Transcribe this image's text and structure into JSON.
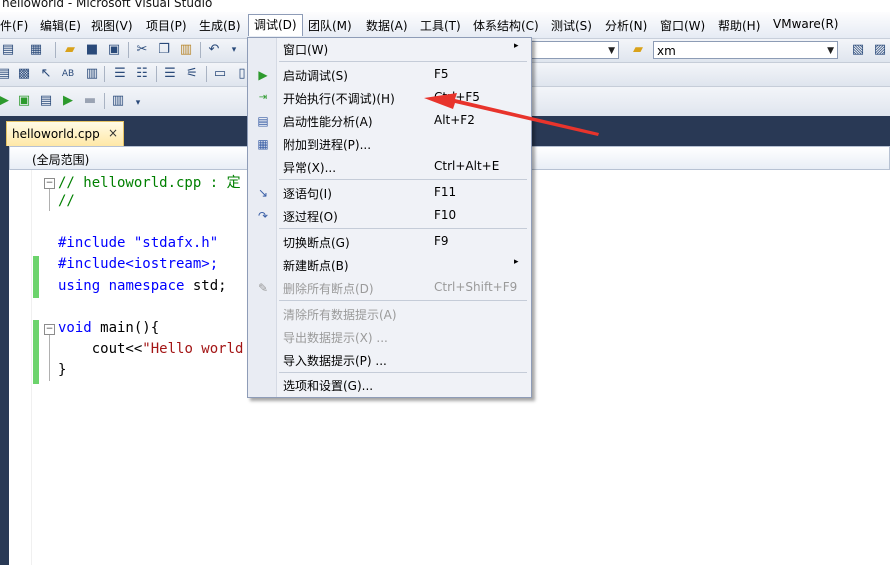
{
  "window": {
    "title": "helloworld - Microsoft Visual Studio"
  },
  "menubar": {
    "items": [
      {
        "label": "件(F)",
        "name": "menu-file"
      },
      {
        "label": "编辑(E)",
        "name": "menu-edit"
      },
      {
        "label": "视图(V)",
        "name": "menu-view"
      },
      {
        "label": "项目(P)",
        "name": "menu-project"
      },
      {
        "label": "生成(B)",
        "name": "menu-build"
      },
      {
        "label": "调试(D)",
        "name": "menu-debug"
      },
      {
        "label": "团队(M)",
        "name": "menu-team"
      },
      {
        "label": "数据(A)",
        "name": "menu-data"
      },
      {
        "label": "工具(T)",
        "name": "menu-tools"
      },
      {
        "label": "体系结构(C)",
        "name": "menu-architecture"
      },
      {
        "label": "测试(S)",
        "name": "menu-test"
      },
      {
        "label": "分析(N)",
        "name": "menu-analyze"
      },
      {
        "label": "窗口(W)",
        "name": "menu-window"
      },
      {
        "label": "帮助(H)",
        "name": "menu-help"
      },
      {
        "label": "VMware(R)",
        "name": "menu-vmware"
      }
    ]
  },
  "toolbar": {
    "search_combo_value": "xm"
  },
  "tabs": {
    "active_file": "helloworld.cpp",
    "close_glyph": "×"
  },
  "navbar": {
    "scope": "(全局范围)"
  },
  "editor": {
    "lines": [
      {
        "c": "// helloworld.cpp : 定"
      },
      {
        "c": "//"
      },
      {
        "inc": "#include \"stdafx.h\""
      },
      {
        "inc": "#include<iostream>;"
      },
      {
        "kw1": "using",
        "kw2": "namespace",
        "rest": " std;"
      },
      {
        "kw": "void",
        "rest": " main(){"
      },
      {
        "pre": "    cout<<",
        "str": "\"Hello world"
      },
      {
        "rest": "}"
      }
    ]
  },
  "debug_menu": {
    "items": [
      {
        "label": "窗口(W)",
        "shortcut": "",
        "submenu": true,
        "disabled": false,
        "icon": ""
      },
      {
        "label": "启动调试(S)",
        "shortcut": "F5",
        "submenu": false,
        "disabled": false,
        "icon": "play-icon"
      },
      {
        "label": "开始执行(不调试)(H)",
        "shortcut": "Ctrl+F5",
        "submenu": false,
        "disabled": false,
        "icon": "run-without-debug-icon"
      },
      {
        "label": "启动性能分析(A)",
        "shortcut": "Alt+F2",
        "submenu": false,
        "disabled": false,
        "icon": "performance-icon"
      },
      {
        "label": "附加到进程(P)...",
        "shortcut": "",
        "submenu": false,
        "disabled": false,
        "icon": "attach-process-icon"
      },
      {
        "label": "异常(X)...",
        "shortcut": "Ctrl+Alt+E",
        "submenu": false,
        "disabled": false,
        "icon": ""
      },
      {
        "label": "逐语句(I)",
        "shortcut": "F11",
        "submenu": false,
        "disabled": false,
        "icon": "step-into-icon"
      },
      {
        "label": "逐过程(O)",
        "shortcut": "F10",
        "submenu": false,
        "disabled": false,
        "icon": "step-over-icon"
      },
      {
        "label": "切换断点(G)",
        "shortcut": "F9",
        "submenu": false,
        "disabled": false,
        "icon": ""
      },
      {
        "label": "新建断点(B)",
        "shortcut": "",
        "submenu": true,
        "disabled": false,
        "icon": ""
      },
      {
        "label": "删除所有断点(D)",
        "shortcut": "Ctrl+Shift+F9",
        "submenu": false,
        "disabled": true,
        "icon": "delete-breakpoints-icon"
      },
      {
        "label": "清除所有数据提示(A)",
        "shortcut": "",
        "submenu": false,
        "disabled": true,
        "icon": ""
      },
      {
        "label": "导出数据提示(X) ...",
        "shortcut": "",
        "submenu": false,
        "disabled": true,
        "icon": ""
      },
      {
        "label": "导入数据提示(P) ...",
        "shortcut": "",
        "submenu": false,
        "disabled": false,
        "icon": ""
      },
      {
        "label": "选项和设置(G)...",
        "shortcut": "",
        "submenu": false,
        "disabled": false,
        "icon": ""
      }
    ],
    "submenu_glyph": "▸"
  },
  "colors": {
    "annotation_arrow": "#e8342c",
    "chrome_dark": "#293955"
  }
}
